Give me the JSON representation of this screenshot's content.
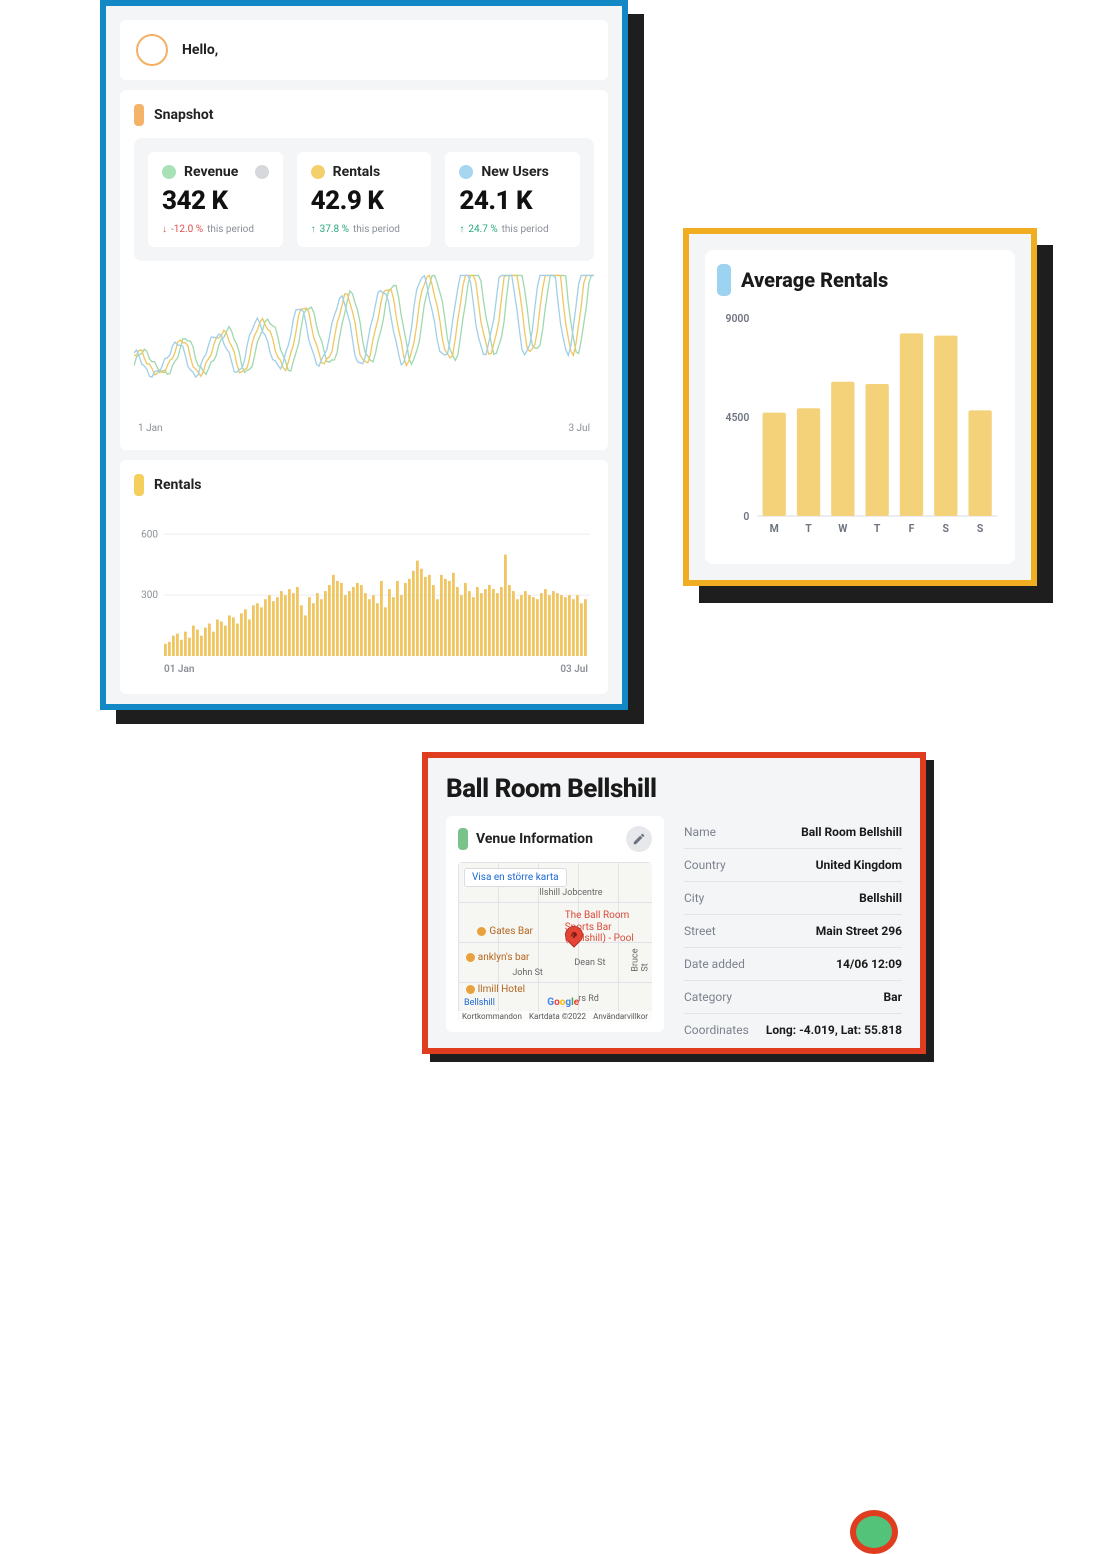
{
  "dashboard": {
    "greeting": "Hello,",
    "snapshot_title": "Snapshot",
    "metrics": [
      {
        "label": "Revenue",
        "value": "342 K",
        "change": "-12.0 %",
        "change_dir": "down",
        "period": "this period"
      },
      {
        "label": "Rentals",
        "value": "42.9 K",
        "change": "37.8 %",
        "change_dir": "up",
        "period": "this period"
      },
      {
        "label": "New Users",
        "value": "24.1 K",
        "change": "24.7 %",
        "change_dir": "up",
        "period": "this period"
      }
    ],
    "line_axis": {
      "start": "1 Jan",
      "end": "3 Jul"
    },
    "rentals": {
      "title": "Rentals",
      "y_ticks": [
        600,
        300
      ],
      "x_start": "01 Jan",
      "x_end": "03 Jul"
    }
  },
  "avg_rentals": {
    "title": "Average Rentals"
  },
  "venue": {
    "title": "Ball Room Bellshill",
    "info_title": "Venue Information",
    "map": {
      "expand_label": "Visa en större karta",
      "callout": "The Ball Room Sports Bar (Bellshill) - Pool",
      "place_link": "Bellshill",
      "attribution": "Kartdata ©2022",
      "shortcuts": "Kortkommandon",
      "terms": "Användarvillkor",
      "poi_gates": "Gates Bar",
      "poi_anklyns": "anklyn's bar",
      "poi_hotel": "llmill Hotel",
      "poi_jobcentre": "llshill Jobcentre",
      "street_john": "John St",
      "street_dean": "Dean St",
      "street_bruce": "Bruce St",
      "street_rd": "rs Rd"
    },
    "fields": [
      {
        "key": "Name",
        "value": "Ball Room Bellshill"
      },
      {
        "key": "Country",
        "value": "United Kingdom"
      },
      {
        "key": "City",
        "value": "Bellshill"
      },
      {
        "key": "Street",
        "value": "Main Street 296"
      },
      {
        "key": "Date added",
        "value": "14/06 12:09"
      },
      {
        "key": "Category",
        "value": "Bar"
      },
      {
        "key": "Coordinates",
        "value": "Long: -4.019, Lat: 55.818"
      }
    ]
  },
  "chart_data": [
    {
      "type": "bar",
      "title": "Average Rentals",
      "categories": [
        "M",
        "T",
        "W",
        "T",
        "F",
        "S",
        "S"
      ],
      "values": [
        4700,
        4900,
        6100,
        6000,
        8300,
        8200,
        4800
      ],
      "ylabel": "",
      "xlabel": "",
      "y_ticks": [
        0,
        4500,
        9000
      ],
      "ylim": [
        0,
        9000
      ]
    },
    {
      "type": "bar",
      "title": "Rentals",
      "x_range": [
        "01 Jan",
        "03 Jul"
      ],
      "ylim": [
        0,
        700
      ],
      "y_ticks": [
        300,
        600
      ],
      "values": [
        60,
        70,
        100,
        110,
        80,
        120,
        90,
        150,
        130,
        100,
        140,
        160,
        120,
        180,
        170,
        150,
        200,
        190,
        160,
        210,
        230,
        180,
        250,
        260,
        240,
        280,
        300,
        270,
        290,
        320,
        300,
        330,
        310,
        340,
        250,
        200,
        290,
        260,
        310,
        280,
        320,
        350,
        400,
        370,
        360,
        300,
        320,
        340,
        360,
        350,
        310,
        280,
        300,
        260,
        370,
        240,
        330,
        290,
        370,
        300,
        360,
        380,
        420,
        470,
        430,
        390,
        400,
        350,
        280,
        400,
        380,
        370,
        410,
        340,
        300,
        360,
        320,
        290,
        340,
        310,
        330,
        350,
        330,
        310,
        340,
        500,
        350,
        320,
        280,
        300,
        320,
        300,
        290,
        280,
        310,
        330,
        300,
        320,
        310,
        300,
        290,
        300,
        280,
        300,
        260,
        280
      ]
    },
    {
      "type": "line",
      "title": "Snapshot",
      "x_range": [
        "1 Jan",
        "3 Jul"
      ],
      "series": [
        {
          "name": "Revenue",
          "color": "#9fd9ae"
        },
        {
          "name": "Rentals",
          "color": "#f0c662"
        },
        {
          "name": "New Users",
          "color": "#a2cfe8"
        }
      ],
      "note": "High-frequency daily series with upward trend and oscillation; exact values not readable."
    }
  ]
}
